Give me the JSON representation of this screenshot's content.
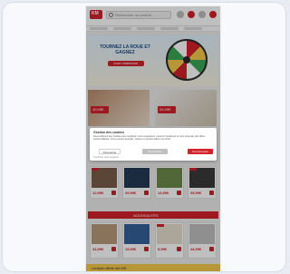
{
  "header": {
    "search_placeholder": "Rechercher un produit...",
    "logo_text": "KM"
  },
  "banner": {
    "title": "TOURNEZ LA ROUE ET GAGNEZ",
    "cta": "Jouer maintenant"
  },
  "promos": [
    {
      "price": "19,99€"
    },
    {
      "price": "24,99€"
    }
  ],
  "cookie_modal": {
    "title": "Gestion des cookies",
    "text": "Nous utilisons des cookies pour améliorer votre expérience, mesurer l'audience et vous proposer des offres personnalisées. Vous pouvez accepter, refuser ou personnaliser vos choix.",
    "button_settings": "Paramétrer",
    "button_refuse": "Tout refuser",
    "button_accept": "Tout accepter",
    "link": "Continuer sans accepter"
  },
  "products_row1": [
    {
      "price": "12,99€",
      "color": "#7a5c48"
    },
    {
      "price": "29,99€",
      "color": "#243a55"
    },
    {
      "price": "14,99€",
      "color": "#6e8a4a"
    },
    {
      "price": "39,99€",
      "color": "#3a3a3a"
    }
  ],
  "section_title": "NOUVEAUTÉS",
  "products_row2": [
    {
      "price": "34,99€",
      "color": "#b79a78"
    },
    {
      "price": "19,99€",
      "color": "#35609a"
    },
    {
      "price": "9,99€",
      "color": "#e6dccd"
    },
    {
      "price": "44,99€",
      "color": "#bfbfbf"
    }
  ],
  "bottom_strip": "Livraison offerte dès 49€"
}
